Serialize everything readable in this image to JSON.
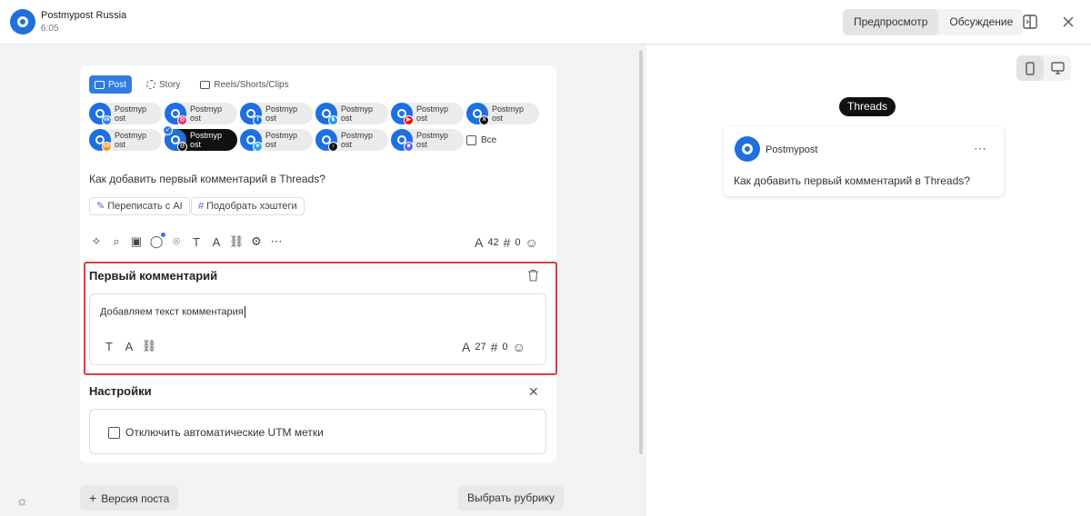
{
  "header": {
    "account_name": "Postmypost Russia",
    "time": "6:05",
    "tabs": [
      {
        "label": "Предпросмотр",
        "active": true
      },
      {
        "label": "Обсуждение",
        "active": false
      }
    ],
    "icons": [
      "split-view-icon",
      "close-icon"
    ]
  },
  "post_types": [
    {
      "label": "Post",
      "active": true,
      "icon": "post-icon"
    },
    {
      "label": "Story",
      "active": false,
      "icon": "story-icon"
    },
    {
      "label": "Reels/Shorts/Clips",
      "active": false,
      "icon": "reels-icon"
    }
  ],
  "channels": [
    {
      "line1": "Postmyp",
      "line2": "ost",
      "network": "vk",
      "color": "#2787f5",
      "mark": "vk"
    },
    {
      "line1": "Postmyp",
      "line2": "ost",
      "network": "instagram",
      "color": "#e1306c",
      "mark": "◎"
    },
    {
      "line1": "Postmyp",
      "line2": "ost",
      "network": "facebook",
      "color": "#1877f2",
      "mark": "f"
    },
    {
      "line1": "Postmyp",
      "line2": "ost",
      "network": "bluesky",
      "color": "#1d9bf0",
      "mark": "♞"
    },
    {
      "line1": "Postmyp",
      "line2": "ost",
      "network": "youtube",
      "color": "#ff0000",
      "mark": "▶"
    },
    {
      "line1": "Postmyp",
      "line2": "ost",
      "network": "x",
      "color": "#111111",
      "mark": "X"
    },
    {
      "line1": "Postmyp",
      "line2": "ost",
      "network": "odnoklassniki",
      "color": "#f7931e",
      "mark": "ok"
    },
    {
      "line1": "Postmyp",
      "line2": "ost",
      "network": "threads",
      "color": "#111111",
      "mark": "@",
      "active": true,
      "checked": true
    },
    {
      "line1": "Postmyp",
      "line2": "ost",
      "network": "telegram",
      "color": "#2aabee",
      "mark": "➤"
    },
    {
      "line1": "Postmyp",
      "line2": "ost",
      "network": "tiktok",
      "color": "#111111",
      "mark": "♪"
    },
    {
      "line1": "Postmyp",
      "line2": "ost",
      "network": "discord",
      "color": "#5865f2",
      "mark": "☻"
    }
  ],
  "all_label": "Все",
  "post_text": "Как добавить первый комментарий в Threads?",
  "ai_buttons": {
    "rewrite": "Переписать с AI",
    "hashtags": "Подобрать хэштеги"
  },
  "toolbar_icons": [
    "sparkle-icon",
    "attach-icon",
    "media-icon",
    "comment-icon",
    "location-icon",
    "text-format-icon",
    "font-style-icon",
    "link-icon",
    "settings-icon",
    "more-icon"
  ],
  "post_counters": {
    "chars": "42",
    "hashtags": "0"
  },
  "first_comment": {
    "title": "Первый комментарий",
    "text": "Добавляем текст комментария",
    "chars": "27",
    "hashtags": "0"
  },
  "settings": {
    "title": "Настройки",
    "utm_label": "Отключить автоматические UTM метки",
    "utm_checked": false
  },
  "bottom": {
    "version_label": "Версия поста",
    "rubric_label": "Выбрать рубрику"
  },
  "preview": {
    "network_label": "Threads",
    "author": "Postmypost",
    "text": "Как добавить первый комментарий в Threads?",
    "devices": [
      {
        "name": "mobile",
        "active": true
      },
      {
        "name": "desktop",
        "active": false
      }
    ]
  },
  "colors": {
    "brand": "#1e6fe0",
    "active_type": "#2f7de1",
    "highlight_border": "#e03c3c"
  }
}
